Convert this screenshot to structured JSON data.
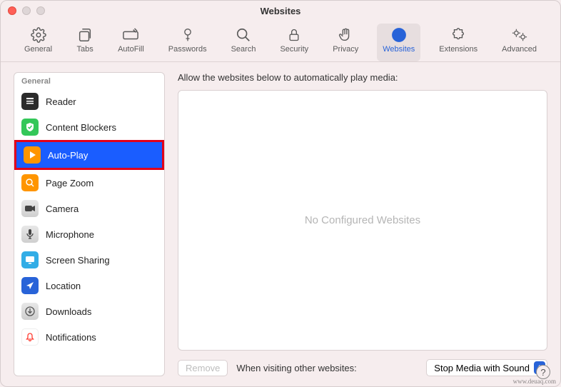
{
  "window": {
    "title": "Websites"
  },
  "toolbar": {
    "items": [
      {
        "id": "general",
        "label": "General"
      },
      {
        "id": "tabs",
        "label": "Tabs"
      },
      {
        "id": "autofill",
        "label": "AutoFill"
      },
      {
        "id": "passwords",
        "label": "Passwords"
      },
      {
        "id": "search",
        "label": "Search"
      },
      {
        "id": "security",
        "label": "Security"
      },
      {
        "id": "privacy",
        "label": "Privacy"
      },
      {
        "id": "websites",
        "label": "Websites",
        "selected": true
      },
      {
        "id": "extensions",
        "label": "Extensions"
      },
      {
        "id": "advanced",
        "label": "Advanced"
      }
    ]
  },
  "sidebar": {
    "section": "General",
    "items": [
      {
        "id": "reader",
        "label": "Reader"
      },
      {
        "id": "content-blockers",
        "label": "Content Blockers"
      },
      {
        "id": "auto-play",
        "label": "Auto-Play",
        "selected": true,
        "highlighted": true
      },
      {
        "id": "page-zoom",
        "label": "Page Zoom"
      },
      {
        "id": "camera",
        "label": "Camera"
      },
      {
        "id": "microphone",
        "label": "Microphone"
      },
      {
        "id": "screen-sharing",
        "label": "Screen Sharing"
      },
      {
        "id": "location",
        "label": "Location"
      },
      {
        "id": "downloads",
        "label": "Downloads"
      },
      {
        "id": "notifications",
        "label": "Notifications"
      }
    ]
  },
  "main": {
    "instruction": "Allow the websites below to automatically play media:",
    "placeholder": "No Configured Websites",
    "remove_label": "Remove",
    "visiting_label": "When visiting other websites:",
    "dropdown_value": "Stop Media with Sound"
  },
  "watermark": "www.deuaq.com"
}
